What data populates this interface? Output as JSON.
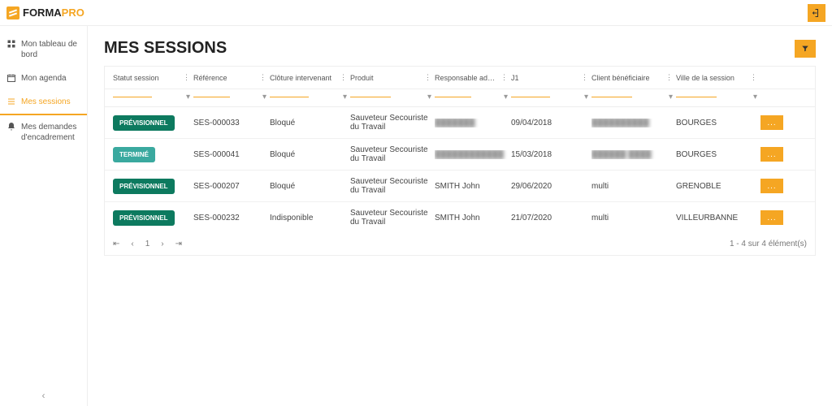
{
  "logo": {
    "part1": "FORMA",
    "part2": "PRO"
  },
  "sidebar": {
    "items": [
      {
        "label": "Mon tableau de bord",
        "icon": "dashboard"
      },
      {
        "label": "Mon agenda",
        "icon": "calendar"
      },
      {
        "label": "Mes sessions",
        "icon": "list",
        "active": true
      },
      {
        "label": "Mes demandes d'encadrement",
        "icon": "bell"
      }
    ]
  },
  "page": {
    "title": "MES SESSIONS"
  },
  "table": {
    "columns": [
      "Statut session",
      "Référence",
      "Clôture intervenant",
      "Produit",
      "Responsable adm...",
      "J1",
      "Client bénéficiaire",
      "Ville de la session"
    ],
    "rows": [
      {
        "status": "PRÉVISIONNEL",
        "statusClass": "prev",
        "ref": "SES-000033",
        "cloture": "Bloqué",
        "produit": "Sauveteur Secouriste du Travail",
        "resp_blur": true,
        "resp": "███████",
        "j1": "09/04/2018",
        "client_blur": true,
        "client": "██████████",
        "ville": "BOURGES"
      },
      {
        "status": "TERMINÉ",
        "statusClass": "term",
        "ref": "SES-000041",
        "cloture": "Bloqué",
        "produit": "Sauveteur Secouriste du Travail",
        "resp_blur": true,
        "resp": "████████████",
        "j1": "15/03/2018",
        "client_blur": true,
        "client": "██████ ████",
        "ville": "BOURGES"
      },
      {
        "status": "PRÉVISIONNEL",
        "statusClass": "prev",
        "ref": "SES-000207",
        "cloture": "Bloqué",
        "produit": "Sauveteur Secouriste du Travail",
        "resp_blur": false,
        "resp": "SMITH John",
        "j1": "29/06/2020",
        "client_blur": false,
        "client": "multi",
        "ville": "GRENOBLE"
      },
      {
        "status": "PRÉVISIONNEL",
        "statusClass": "prev",
        "ref": "SES-000232",
        "cloture": "Indisponible",
        "produit": "Sauveteur Secouriste du Travail",
        "resp_blur": false,
        "resp": "SMITH John",
        "j1": "21/07/2020",
        "client_blur": false,
        "client": "multi",
        "ville": "VILLEURBANNE"
      }
    ]
  },
  "pager": {
    "first": "⇤",
    "prev": "‹",
    "current": "1",
    "next": "›",
    "last": "⇥",
    "info": "1 - 4 sur 4 élément(s)"
  },
  "action_label": "...",
  "collapse_label": "‹"
}
